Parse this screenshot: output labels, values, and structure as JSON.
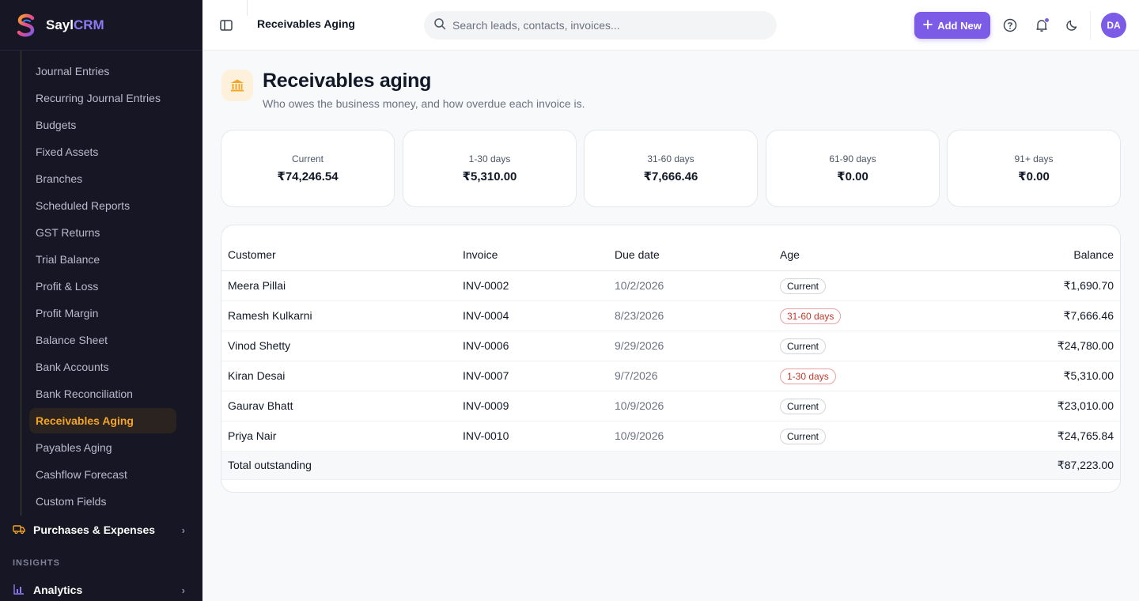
{
  "brand": {
    "name_prefix": "Sayl",
    "name_accent": "CRM"
  },
  "sidebar": {
    "items": [
      {
        "label": "Journal Entries"
      },
      {
        "label": "Recurring Journal Entries"
      },
      {
        "label": "Budgets"
      },
      {
        "label": "Fixed Assets"
      },
      {
        "label": "Branches"
      },
      {
        "label": "Scheduled Reports"
      },
      {
        "label": "GST Returns"
      },
      {
        "label": "Trial Balance"
      },
      {
        "label": "Profit & Loss"
      },
      {
        "label": "Profit Margin"
      },
      {
        "label": "Balance Sheet"
      },
      {
        "label": "Bank Accounts"
      },
      {
        "label": "Bank Reconciliation"
      },
      {
        "label": "Receivables Aging",
        "active": true
      },
      {
        "label": "Payables Aging"
      },
      {
        "label": "Cashflow Forecast"
      },
      {
        "label": "Custom Fields"
      }
    ],
    "group_purchases": "Purchases & Expenses",
    "section_insights": "INSIGHTS",
    "group_analytics": "Analytics"
  },
  "topbar": {
    "title": "Receivables Aging",
    "search_placeholder": "Search leads, contacts, invoices...",
    "add_label": "Add New",
    "avatar_initials": "DA"
  },
  "page": {
    "title": "Receivables aging",
    "subtitle": "Who owes the business money, and how overdue each invoice is."
  },
  "buckets": [
    {
      "label": "Current",
      "value": "₹74,246.54"
    },
    {
      "label": "1-30 days",
      "value": "₹5,310.00"
    },
    {
      "label": "31-60 days",
      "value": "₹7,666.46"
    },
    {
      "label": "61-90 days",
      "value": "₹0.00"
    },
    {
      "label": "91+ days",
      "value": "₹0.00"
    }
  ],
  "table": {
    "headers": {
      "customer": "Customer",
      "invoice": "Invoice",
      "due": "Due date",
      "age": "Age",
      "balance": "Balance"
    },
    "rows": [
      {
        "customer": "Meera Pillai",
        "invoice": "INV-0002",
        "due": "10/2/2026",
        "age": "Current",
        "balance": "₹1,690.70"
      },
      {
        "customer": "Ramesh Kulkarni",
        "invoice": "INV-0004",
        "due": "8/23/2026",
        "age": "31-60 days",
        "balance": "₹7,666.46"
      },
      {
        "customer": "Vinod Shetty",
        "invoice": "INV-0006",
        "due": "9/29/2026",
        "age": "Current",
        "balance": "₹24,780.00"
      },
      {
        "customer": "Kiran Desai",
        "invoice": "INV-0007",
        "due": "9/7/2026",
        "age": "1-30 days",
        "balance": "₹5,310.00"
      },
      {
        "customer": "Gaurav Bhatt",
        "invoice": "INV-0009",
        "due": "10/9/2026",
        "age": "Current",
        "balance": "₹23,010.00"
      },
      {
        "customer": "Priya Nair",
        "invoice": "INV-0010",
        "due": "10/9/2026",
        "age": "Current",
        "balance": "₹24,765.84"
      }
    ],
    "total_label": "Total outstanding",
    "total_value": "₹87,223.00"
  },
  "colors": {
    "accent": "#7c5ce6",
    "active_nav": "#f5a524",
    "overdue": "#c0392b"
  }
}
